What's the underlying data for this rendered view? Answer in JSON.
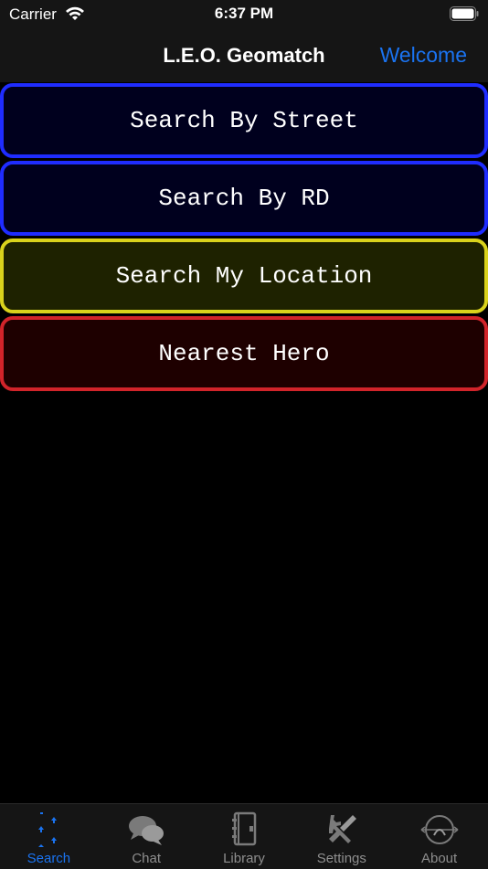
{
  "status_bar": {
    "carrier": "Carrier",
    "time": "6:37 PM"
  },
  "nav": {
    "title": "L.E.O. Geomatch",
    "right_button": "Welcome"
  },
  "menu": [
    {
      "label": "Search By Street",
      "border": "#1f2cff",
      "bg": "#00001e"
    },
    {
      "label": "Search By RD",
      "border": "#1f2cff",
      "bg": "#00001e"
    },
    {
      "label": "Search My Location",
      "border": "#d9d21c",
      "bg": "#1e2200"
    },
    {
      "label": "Nearest Hero",
      "border": "#d1242a",
      "bg": "#1e0000"
    }
  ],
  "tabs": [
    {
      "label": "Search",
      "icon": "search-footprints-icon",
      "active": true
    },
    {
      "label": "Chat",
      "icon": "chat-bubbles-icon",
      "active": false
    },
    {
      "label": "Library",
      "icon": "library-book-icon",
      "active": false
    },
    {
      "label": "Settings",
      "icon": "settings-tools-icon",
      "active": false
    },
    {
      "label": "About",
      "icon": "about-logo-icon",
      "active": false
    }
  ],
  "colors": {
    "accent": "#1a73f0",
    "bar_bg": "#151515",
    "inactive": "#8e8e8e"
  }
}
